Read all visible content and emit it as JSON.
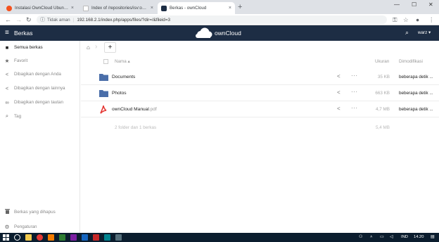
{
  "browser": {
    "tabs": [
      {
        "title": "Instalasi OwnCloud Ubuntu 16.0...",
        "close": "×",
        "favicon_color": "#f4511e"
      },
      {
        "title": "Index of /repositories/isv:ownCl...",
        "close": "×",
        "favicon_color": "#bdbdbd"
      },
      {
        "title": "Berkas - ownCloud",
        "close": "×",
        "favicon_color": "#1d2d44"
      }
    ],
    "new_tab": "+",
    "win_min": "—",
    "win_max": "☐",
    "win_close": "✕",
    "back": "←",
    "forward": "→",
    "reload": "↻",
    "security": "Tidak aman",
    "url": "192.168.2.1/index.php/apps/files/?dir=/&fileid=3",
    "key": "⚿",
    "star": "☆",
    "account": "●",
    "menu": "⋮"
  },
  "header": {
    "menu_icon": "≡",
    "app_name": "Berkas",
    "logo_text": "ownCloud",
    "search_icon": "⌕",
    "user": "warz ▾"
  },
  "sidebar": {
    "items": [
      {
        "label": "Semua berkas",
        "icon": "■"
      },
      {
        "label": "Favorit",
        "icon": "★"
      },
      {
        "label": "Dibagikan dengan Anda",
        "icon": "<"
      },
      {
        "label": "Dibagikan dengan lainnya",
        "icon": "<"
      },
      {
        "label": "Dibagikan dengan tautan",
        "icon": "∞"
      },
      {
        "label": "Tag",
        "icon": "⌕"
      }
    ],
    "bottom": [
      {
        "label": "Berkas yang dihapus",
        "icon": "🗑"
      },
      {
        "label": "Pengaturan",
        "icon": "⚙"
      }
    ]
  },
  "main": {
    "home_icon": "⌂",
    "crumb_sep": "›",
    "new_button": "+",
    "columns": {
      "name": "Nama ▴",
      "size": "Ukuran",
      "modified": "Dimodifikasi"
    },
    "files": [
      {
        "name": "Documents",
        "ext": "",
        "size": "35 KB",
        "modified": "beberapa detik ...",
        "type": "folder"
      },
      {
        "name": "Photos",
        "ext": "",
        "size": "663 KB",
        "modified": "beberapa detik ...",
        "type": "folder"
      },
      {
        "name": "ownCloud Manual",
        "ext": ".pdf",
        "size": "4,7 MB",
        "modified": "beberapa detik ...",
        "type": "pdf"
      }
    ],
    "share_icon": "<",
    "more_icon": "···",
    "summary": {
      "text": "2 folder dan 1 berkas",
      "size": "5,4 MB"
    }
  },
  "taskbar": {
    "lang": "IND",
    "time": "14.20"
  },
  "colors": {
    "header_bg": "#1d2d44",
    "folder": "#4a6ea9",
    "pdf": "#e53935"
  }
}
